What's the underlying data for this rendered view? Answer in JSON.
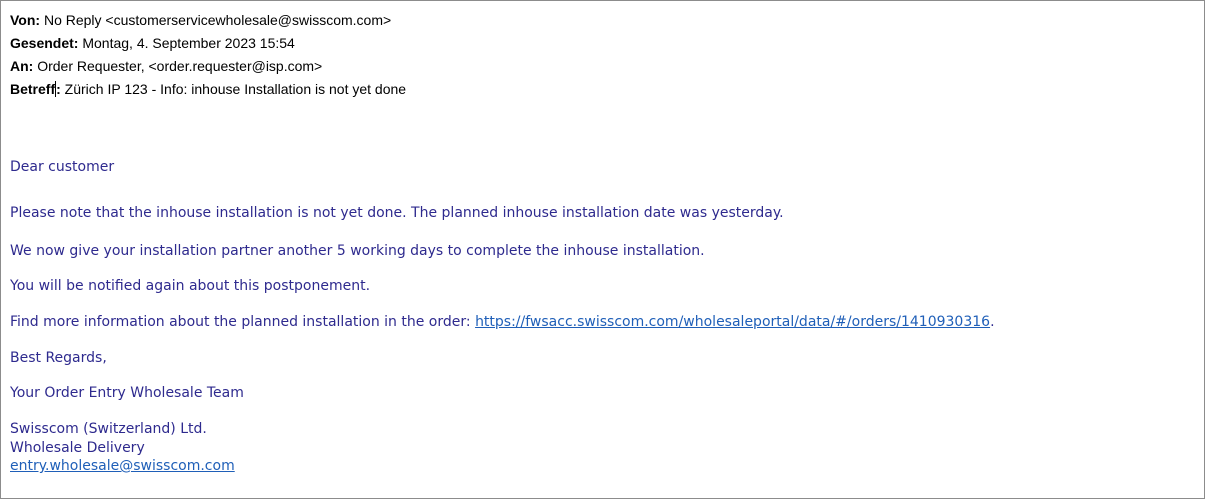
{
  "header": {
    "from_label": "Von:",
    "from_value": " No Reply <customerservicewholesale@swisscom.com>",
    "sent_label": "Gesendet:",
    "sent_value": " Montag, 4. September 2023 15:54",
    "to_label": "An:",
    "to_value": " Order Requester, <order.requester@isp.com>",
    "subject_label_before_cursor": "Betreff",
    "subject_label_after_cursor": ":",
    "subject_value": " Zürich IP 123 - Info: inhouse Installation is not yet done"
  },
  "body": {
    "greeting": "Dear customer",
    "paragraph_1": "Please note that the inhouse installation is not yet done. The planned inhouse installation date was yesterday.",
    "paragraph_2": "We now give your installation partner another 5 working days to complete the inhouse installation.",
    "paragraph_3": "You will be notified again about this postponement.",
    "paragraph_4_prefix": "Find more information about the planned installation in the order: ",
    "paragraph_4_link": "https://fwsacc.swisscom.com/wholesaleportal/data/#/orders/1410930316",
    "paragraph_4_suffix": ".",
    "closing": "Best Regards,",
    "team": "Your Order Entry Wholesale Team",
    "company": "Swisscom (Switzerland) Ltd.",
    "department": "Wholesale Delivery",
    "email_link": "entry.wholesale@swisscom.com"
  },
  "colors": {
    "body_text": "#2e2a8e",
    "link": "#1f5fb8",
    "header_text": "#000000",
    "frame_border": "#8c8c8c"
  }
}
